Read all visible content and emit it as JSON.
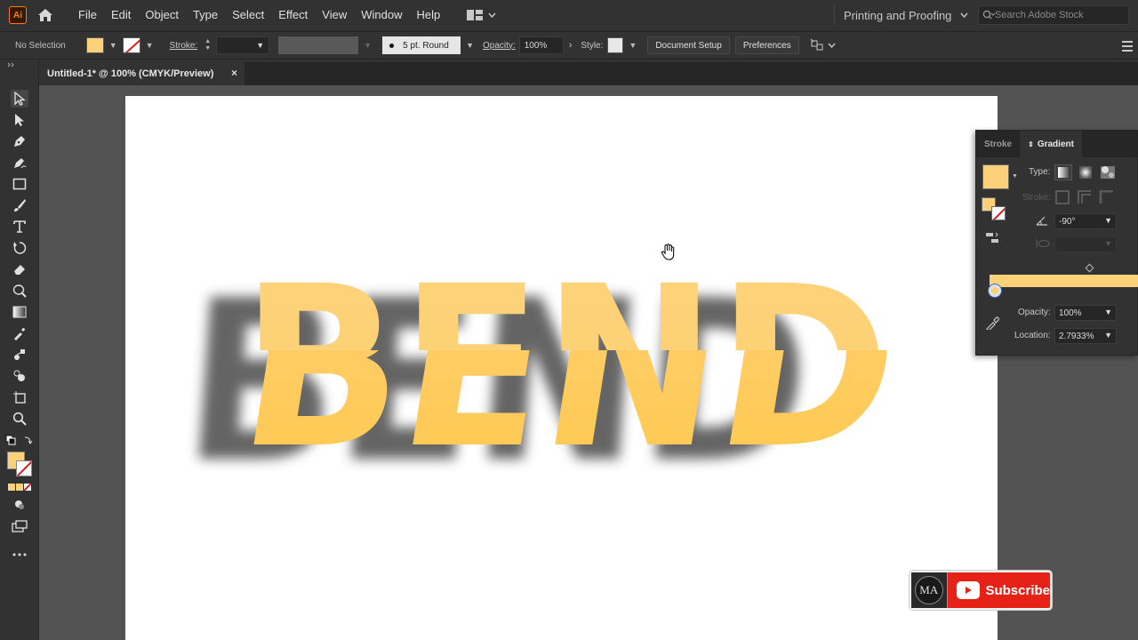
{
  "menubar": {
    "logo": "Ai",
    "items": [
      "File",
      "Edit",
      "Object",
      "Type",
      "Select",
      "Effect",
      "View",
      "Window",
      "Help"
    ],
    "workspace": "Printing and Proofing",
    "search_placeholder": "Search Adobe Stock"
  },
  "controlbar": {
    "selection": "No Selection",
    "stroke_label": "Stroke:",
    "brush": "5 pt. Round",
    "opacity_label": "Opacity:",
    "opacity_value": "100%",
    "style_label": "Style:",
    "document_setup": "Document Setup",
    "preferences": "Preferences",
    "fill_color": "#fdd07a"
  },
  "document": {
    "tab_title": "Untitled-1* @ 100% (CMYK/Preview)",
    "artwork_text": "BEND",
    "artwork_colors": [
      "#fdd27a",
      "#fecb58"
    ]
  },
  "gradient_panel": {
    "tab_stroke": "Stroke",
    "tab_gradient": "Gradient",
    "type_label": "Type:",
    "stroke_label": "Stroke:",
    "angle_value": "-90°",
    "opacity_label": "Opacity:",
    "opacity_value": "100%",
    "location_label": "Location:",
    "location_value": "2.7933%"
  },
  "subscribe": {
    "avatar_text": "MA",
    "label": "Subscribe"
  },
  "colors": {
    "ui_bg": "#323232",
    "pasteboard": "#535353",
    "accent_yellow": "#fdd07a",
    "youtube_red": "#e62117"
  }
}
